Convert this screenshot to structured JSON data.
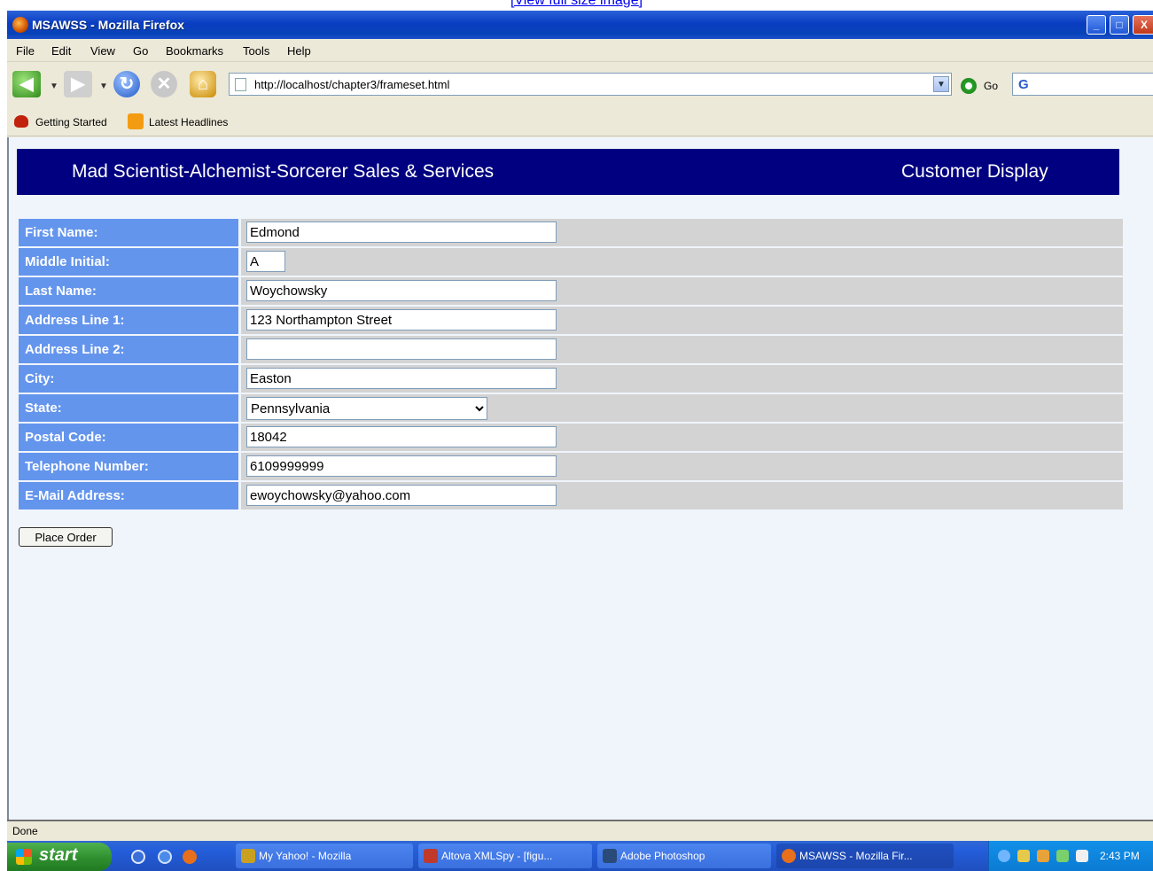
{
  "caption_link": "[View full size image]",
  "window": {
    "title": "MSAWSS - Mozilla Firefox",
    "minimize": "_",
    "maximize": "□",
    "close": "X"
  },
  "menu": [
    "File",
    "Edit",
    "View",
    "Go",
    "Bookmarks",
    "Tools",
    "Help"
  ],
  "nav": {
    "url": "http://localhost/chapter3/frameset.html",
    "go_label": "Go"
  },
  "bookmarks": [
    "Getting Started",
    "Latest Headlines"
  ],
  "banner": {
    "company": "Mad Scientist-Alchemist-Sorcerer Sales & Services",
    "display": "Customer Display"
  },
  "form": {
    "first_name_label": "First Name:",
    "first_name_value": "Edmond",
    "middle_initial_label": "Middle Initial:",
    "middle_initial_value": "A",
    "last_name_label": "Last Name:",
    "last_name_value": "Woychowsky",
    "address1_label": "Address Line 1:",
    "address1_value": "123 Northampton Street",
    "address2_label": "Address Line 2:",
    "address2_value": "",
    "city_label": "City:",
    "city_value": "Easton",
    "state_label": "State:",
    "state_value": "Pennsylvania",
    "postal_label": "Postal Code:",
    "postal_value": "18042",
    "phone_label": "Telephone Number:",
    "phone_value": "6109999999",
    "email_label": "E-Mail Address:",
    "email_value": "ewoychowsky@yahoo.com",
    "submit_label": "Place Order"
  },
  "status": "Done",
  "taskbar": {
    "start": "start",
    "tasks": [
      "My Yahoo! - Mozilla",
      "Altova XMLSpy - [figu...",
      "Adobe Photoshop",
      "MSAWSS - Mozilla Fir..."
    ],
    "clock": "2:43 PM"
  }
}
